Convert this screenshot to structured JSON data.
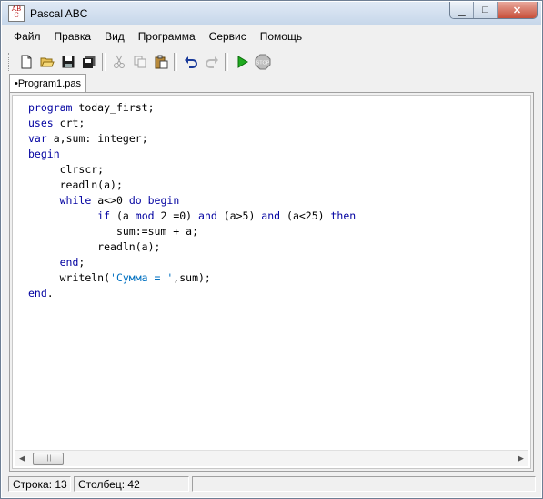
{
  "window": {
    "title": "Pascal ABC",
    "minimize_glyph": "▁",
    "maximize_glyph": "□",
    "close_glyph": "✕"
  },
  "app_icon": {
    "line1": "AB",
    "line2": "C"
  },
  "menu": [
    "Файл",
    "Правка",
    "Вид",
    "Программа",
    "Сервис",
    "Помощь"
  ],
  "toolbar": {
    "buttons": [
      "new-file-icon",
      "open-folder-icon",
      "save-icon",
      "save-all-icon",
      "cut-icon",
      "copy-icon",
      "paste-icon",
      "undo-icon",
      "redo-icon",
      "run-icon",
      "stop-icon"
    ],
    "stop_label": "STOP"
  },
  "tab": {
    "label": "•Program1.pas"
  },
  "code": [
    "program today_first;",
    "uses crt;",
    "var a,sum: integer;",
    "begin",
    "     clrscr;",
    "     readln(a);",
    "     while a<>0 do begin",
    "           if (a mod 2 =0) and (a>5) and (a<25) then",
    "              sum:=sum + a;",
    "           readln(a);",
    "     end;",
    "     writeln('Сумма = ',sum);",
    "end."
  ],
  "scrollbar": {
    "thumb_grip": "|||"
  },
  "status": {
    "row": "Строка: 13",
    "col": "Столбец: 42"
  },
  "colors": {
    "keyword": "#0000a0",
    "string": "#0070c0",
    "run": "#1faa1f"
  }
}
